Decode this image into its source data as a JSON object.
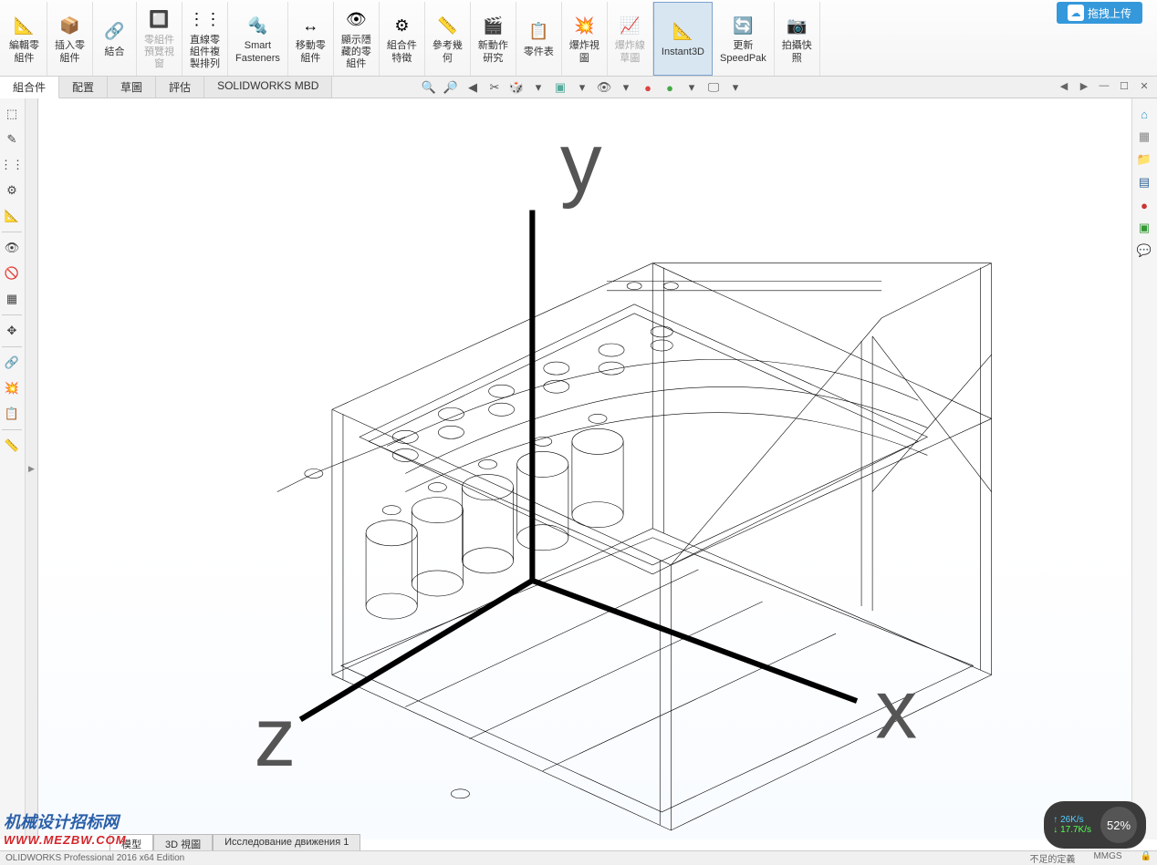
{
  "upload_button": "拖拽上传",
  "ribbon": [
    {
      "label": "編輯零\n組件",
      "icon": "📐",
      "disabled": false
    },
    {
      "label": "插入零\n組件",
      "icon": "📦",
      "disabled": false
    },
    {
      "label": "結合",
      "icon": "🔗",
      "disabled": false
    },
    {
      "label": "零組件\n預覽視\n窗",
      "icon": "🔲",
      "disabled": true
    },
    {
      "label": "直線零\n組件複\n製排列",
      "icon": "⋮⋮",
      "disabled": false
    },
    {
      "label": "Smart\nFasteners",
      "icon": "🔩",
      "disabled": false
    },
    {
      "label": "移動零\n組件",
      "icon": "↔",
      "disabled": false
    },
    {
      "label": "顯示隱\n藏的零\n組件",
      "icon": "👁",
      "disabled": false
    },
    {
      "label": "組合件\n特徵",
      "icon": "⚙",
      "disabled": false
    },
    {
      "label": "參考幾\n何",
      "icon": "📏",
      "disabled": false
    },
    {
      "label": "新動作\n研究",
      "icon": "🎬",
      "disabled": false
    },
    {
      "label": "零件表",
      "icon": "📋",
      "disabled": false
    },
    {
      "label": "爆炸視\n圖",
      "icon": "💥",
      "disabled": false
    },
    {
      "label": "爆炸線\n草圖",
      "icon": "📈",
      "disabled": true
    },
    {
      "label": "Instant3D",
      "icon": "📐",
      "disabled": false,
      "active": true
    },
    {
      "label": "更新\nSpeedPak",
      "icon": "🔄",
      "disabled": false
    },
    {
      "label": "拍攝快\n照",
      "icon": "📷",
      "disabled": false
    }
  ],
  "tabs": [
    {
      "label": "組合件",
      "active": true
    },
    {
      "label": "配置",
      "active": false
    },
    {
      "label": "草圖",
      "active": false
    },
    {
      "label": "評估",
      "active": false
    },
    {
      "label": "SOLIDWORKS MBD",
      "active": false
    }
  ],
  "bottom_tabs": [
    {
      "label": "模型",
      "active": true
    },
    {
      "label": "3D 視圖",
      "active": false
    },
    {
      "label": "Исследование движения 1",
      "active": false
    }
  ],
  "status_left": "OLIDWORKS Professional 2016 x64 Edition",
  "status_right": {
    "def": "不足的定義",
    "units": "MMGS"
  },
  "triad": {
    "x": "x",
    "y": "y",
    "z": "z"
  },
  "speed": {
    "up": "26K/s",
    "down": "17.7K/s",
    "pct": "52%"
  },
  "watermark": {
    "line1": "机械设计招标网",
    "line2": "WWW.MEZBW.COM"
  }
}
